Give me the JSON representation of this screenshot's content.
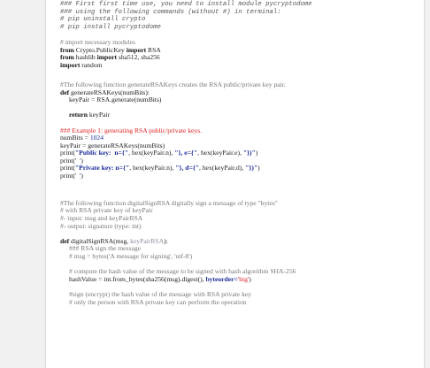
{
  "header_comments": [
    "### First first time use, you need to install module pycryptodome",
    "### using the following commands (without #) in terminal:",
    "# pip uninstall crypto",
    "# pip install pycryptodome"
  ],
  "imports": {
    "comment": "# import necessary modules",
    "line1": {
      "kw1": "from",
      "mod": " Crypto.PublicKey ",
      "kw2": "import",
      "name": " RSA"
    },
    "line2": {
      "kw1": "from",
      "mod": " hashlib ",
      "kw2": "import",
      "name": " sha512, sha256"
    },
    "line3": {
      "kw1": "import",
      "name": " random"
    }
  },
  "gen_func": {
    "comment": "#The following function generateRSAKeys creates the RSA public/private key pair.",
    "def_kw": "def",
    "signature": " generateRSAKeys(numBits):",
    "body": "keyPair = RSA.generate(numBits)",
    "return_kw": "return",
    "return_val": " keyPair"
  },
  "example": {
    "comment": "### Example 1: generating RSA public/private keys.",
    "numbits_name": "numBits = ",
    "numbits_val": "1024",
    "keypair": "keyPair = generateRSAKeys(numBits)",
    "print1_a": "print(",
    "print1_s1": "\"Public key:  n={\"",
    "print1_b": ", hex(keyPair.n), ",
    "print1_s2": "\"}, e={\"",
    "print1_c": ", hex(keyPair.e), ",
    "print1_s3": "\"})\"",
    "print1_d": ")",
    "print_blank1": "print('  ')",
    "print2_a": "print(",
    "print2_s1": "\"Private key: n={\"",
    "print2_b": ", hex(keyPair.n), ",
    "print2_s2": "\"}, d={\"",
    "print2_c": ", hex(keyPair.d), ",
    "print2_s3": "\"})\"",
    "print2_d": ")",
    "print_blank2": "print('  ')"
  },
  "sign_comments": [
    "#The following function digitalSignRSA digitally sign a message of type \"bytes\"",
    "# with RSA private key of keyPair",
    "#- input: msg and keyPairRSA",
    "#- output: signature (type: int)"
  ],
  "sign_func": {
    "def_kw": "def",
    "name": " digitalSignRSA(msg, ",
    "param_dim": "keyPairRSA",
    "close": "):",
    "c1": "### RSA sign the message",
    "c2": "# msg = bytes('A message for signing', 'utf-8')",
    "c3": "# compute the hash value of the message to be signed with hash algorithm SHA-256",
    "hash_a": "hashValue = int.from_bytes(sha256(msg).digest(), ",
    "hash_kw": "byteorder=",
    "hash_s": "'big'",
    "hash_c": ")",
    "c4": "#sign (encrypt) the hash value of the message with RSA private key",
    "c5": "# only the person with RSA private key can perform the operation"
  }
}
